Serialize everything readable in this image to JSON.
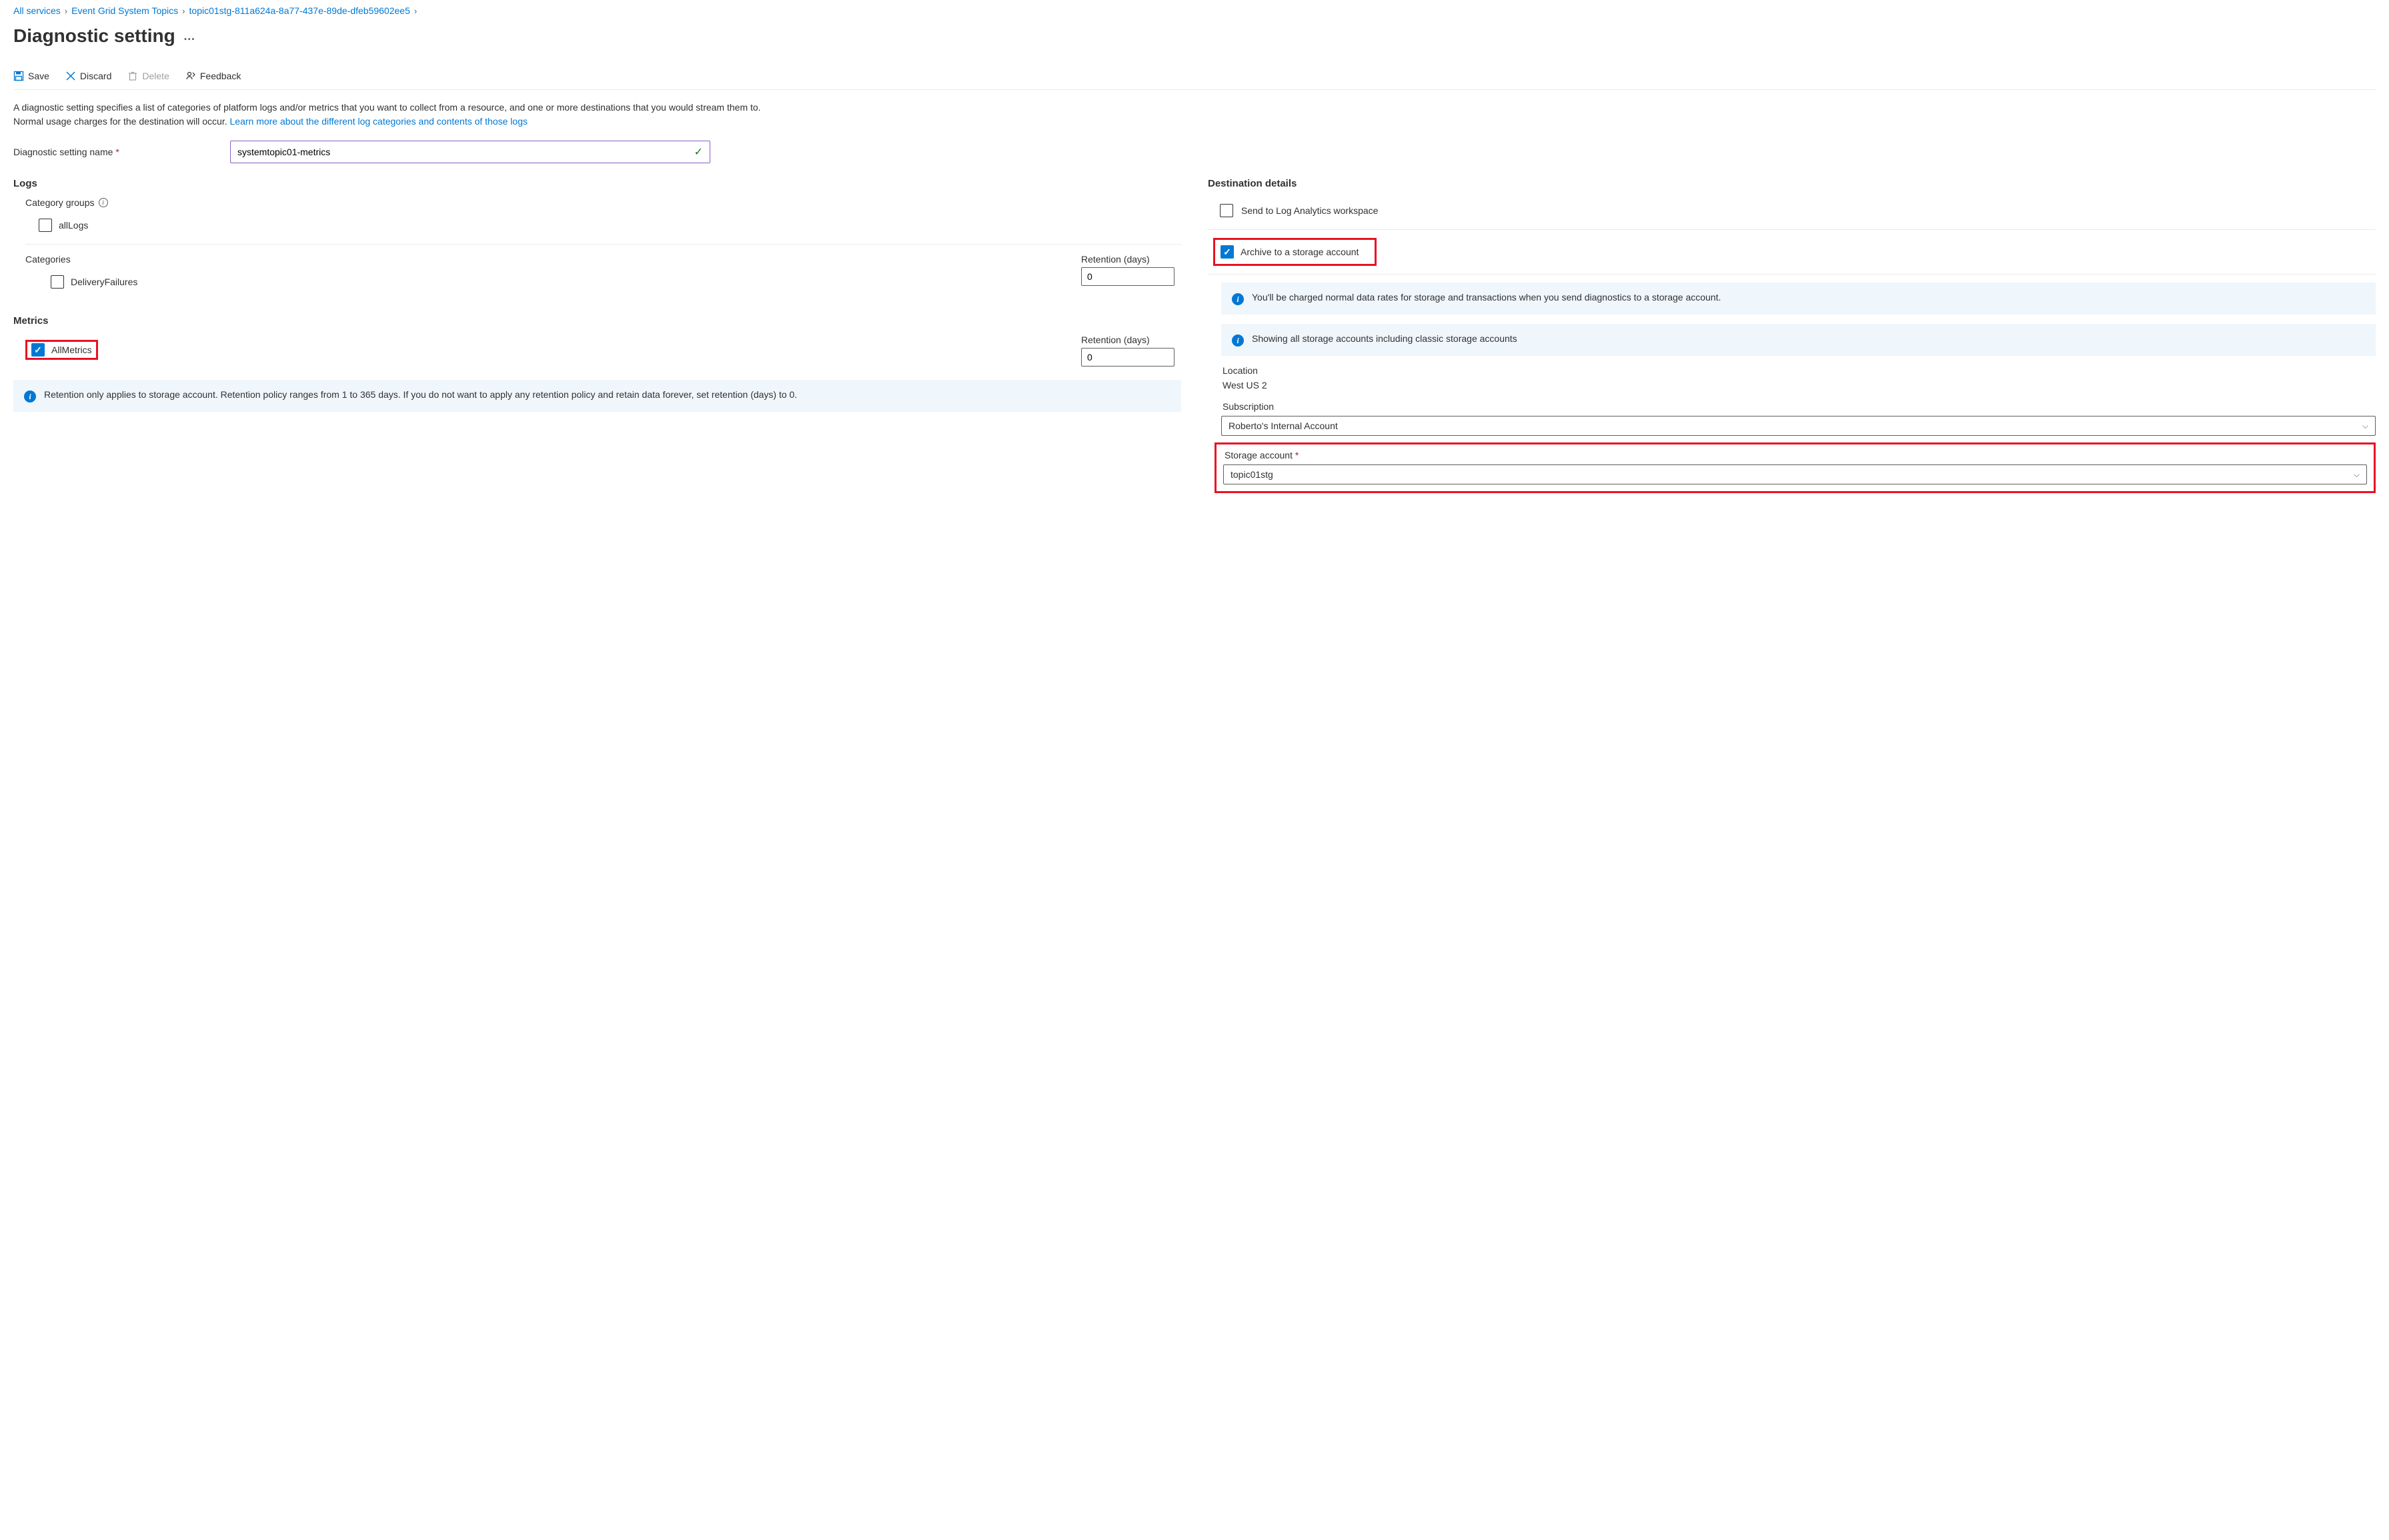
{
  "breadcrumb": {
    "items": [
      "All services",
      "Event Grid System Topics",
      "topic01stg-811a624a-8a77-437e-89de-dfeb59602ee5"
    ]
  },
  "page_title": "Diagnostic setting",
  "toolbar": {
    "save": "Save",
    "discard": "Discard",
    "delete": "Delete",
    "feedback": "Feedback"
  },
  "description": {
    "text1": "A diagnostic setting specifies a list of categories of platform logs and/or metrics that you want to collect from a resource, and one or more destinations that you would stream them to. Normal usage charges for the destination will occur. ",
    "link": "Learn more about the different log categories and contents of those logs"
  },
  "name_field": {
    "label": "Diagnostic setting name",
    "value": "systemtopic01-metrics"
  },
  "logs": {
    "title": "Logs",
    "category_groups_label": "Category groups",
    "all_logs": "allLogs",
    "categories_label": "Categories",
    "delivery_failures": "DeliveryFailures",
    "retention_label": "Retention (days)",
    "retention_value": "0"
  },
  "metrics": {
    "title": "Metrics",
    "all_metrics": "AllMetrics",
    "retention_label": "Retention (days)",
    "retention_value": "0"
  },
  "retention_info": "Retention only applies to storage account. Retention policy ranges from 1 to 365 days. If you do not want to apply any retention policy and retain data forever, set retention (days) to 0.",
  "destination": {
    "title": "Destination details",
    "log_analytics": "Send to Log Analytics workspace",
    "archive_storage": "Archive to a storage account",
    "charge_info": "You'll be charged normal data rates for storage and transactions when you send diagnostics to a storage account.",
    "showing_info": "Showing all storage accounts including classic storage accounts",
    "location_label": "Location",
    "location_value": "West US 2",
    "subscription_label": "Subscription",
    "subscription_value": "Roberto's Internal Account",
    "storage_label": "Storage account",
    "storage_value": "topic01stg"
  }
}
